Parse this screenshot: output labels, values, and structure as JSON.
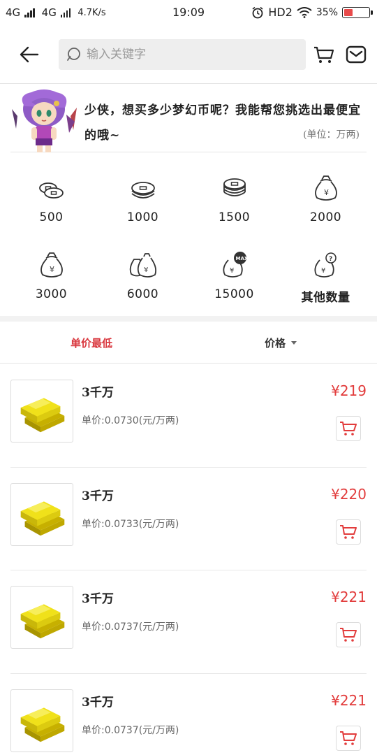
{
  "status_bar": {
    "network1": "4G",
    "network2": "4G",
    "speed": "4.7K/s",
    "time": "19:09",
    "hd": "HD2",
    "battery_pct": "35%",
    "battery_level": 0.35
  },
  "search": {
    "placeholder": "输入关键字"
  },
  "banner": {
    "message": "少侠，想买多少梦幻币呢？我能帮您挑选出最便宜的哦~",
    "unit": "(单位：万两)"
  },
  "quantities": [
    {
      "label": "500",
      "icon": "coins-small-icon"
    },
    {
      "label": "1000",
      "icon": "coins-medium-icon"
    },
    {
      "label": "1500",
      "icon": "coins-stack-icon"
    },
    {
      "label": "2000",
      "icon": "money-bag-icon"
    },
    {
      "label": "3000",
      "icon": "money-bag-icon"
    },
    {
      "label": "6000",
      "icon": "money-bags-icon"
    },
    {
      "label": "15000",
      "icon": "money-bag-max-icon"
    },
    {
      "label": "其他数量",
      "icon": "money-bag-question-icon"
    }
  ],
  "sort": {
    "lowest_unit_price": "单价最低",
    "price": "价格"
  },
  "products": [
    {
      "title": "3千万",
      "unit_price": "单价:0.0730(元/万两)",
      "price": "¥219"
    },
    {
      "title": "3千万",
      "unit_price": "单价:0.0733(元/万两)",
      "price": "¥220"
    },
    {
      "title": "3千万",
      "unit_price": "单价:0.0737(元/万两)",
      "price": "¥221"
    },
    {
      "title": "3千万",
      "unit_price": "单价:0.0737(元/万两)",
      "price": "¥221"
    }
  ],
  "colors": {
    "accent": "#d9373e",
    "price": "#e23c3c"
  }
}
